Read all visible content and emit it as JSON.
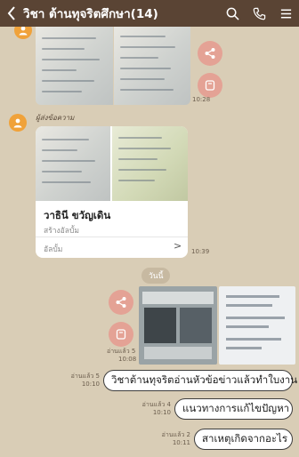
{
  "header": {
    "title": "วิชา ต้านทุจริตศึกษา(14)",
    "back_icon": "chevron-left-icon",
    "search_icon": "search-icon",
    "call_icon": "phone-icon",
    "menu_icon": "menu-icon"
  },
  "messages": {
    "top_photo": {
      "time": "10:28"
    },
    "album": {
      "sender": "ผู้ส่งข้อความ",
      "title": "วาธินี ขวัญเดิน",
      "subtitle": "สร้างอัลบั้ม",
      "footer_label": "อัลบั้ม",
      "chevron": ">",
      "time": "10:39"
    },
    "date_divider": "วันนี้",
    "sent_photo": {
      "read": "อ่านแล้ว 5",
      "time": "10:08"
    },
    "sent_texts": [
      {
        "read": "อ่านแล้ว 5",
        "time": "10:10",
        "text": "วิชาต้านทุจริตอ่านหัวข้อข่าวแล้วทำใบงาน"
      },
      {
        "read": "อ่านแล้ว 4",
        "time": "10:10",
        "text": "แนวทางการแก้ไขปัญหา"
      },
      {
        "read": "อ่านแล้ว 2",
        "time": "10:11",
        "text": "สาเหตุเกิดจากอะไร"
      }
    ]
  },
  "colors": {
    "header_bg": "#5a4434",
    "chat_bg": "#d9cdb6",
    "action_button": "#e4a295",
    "avatar": "#f0a23a"
  }
}
